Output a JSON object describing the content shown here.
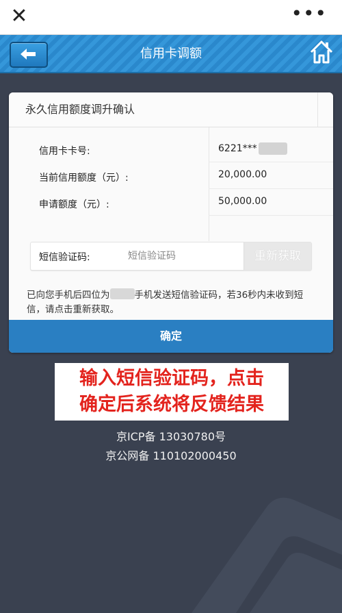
{
  "browser": {
    "close_icon": "close-icon",
    "more_icon": "more-icon"
  },
  "header": {
    "title": "信用卡调额",
    "back_icon": "back-arrow-icon",
    "home_icon": "home-icon"
  },
  "card": {
    "title": "永久信用额度调升确认",
    "rows": [
      {
        "label": "信用卡卡号:",
        "value": "6221***"
      },
      {
        "label": "当前信用额度（元）:",
        "value": "20,000.00"
      },
      {
        "label": "申请额度（元）:",
        "value": "50,000.00"
      }
    ],
    "sms": {
      "label": "短信验证码:",
      "placeholder": "短信验证码",
      "resend_label": "重新获取"
    },
    "notice_part1": "已向您手机后四位为",
    "notice_part2": "手机发送短信验证码，若36秒内未收到短信，请点击重新获取。",
    "confirm_label": "确定"
  },
  "overlay": {
    "line1": "输入短信验证码，点击",
    "line2": "确定后系统将反馈结果"
  },
  "footer": {
    "icp": "京ICP备 13030780号",
    "police": "京公网备 110102000450"
  },
  "colors": {
    "header_blue": "#2a88cc",
    "confirm_blue": "#2a7fc2",
    "overlay_red": "#e3231d",
    "page_bg": "#3a4150"
  }
}
